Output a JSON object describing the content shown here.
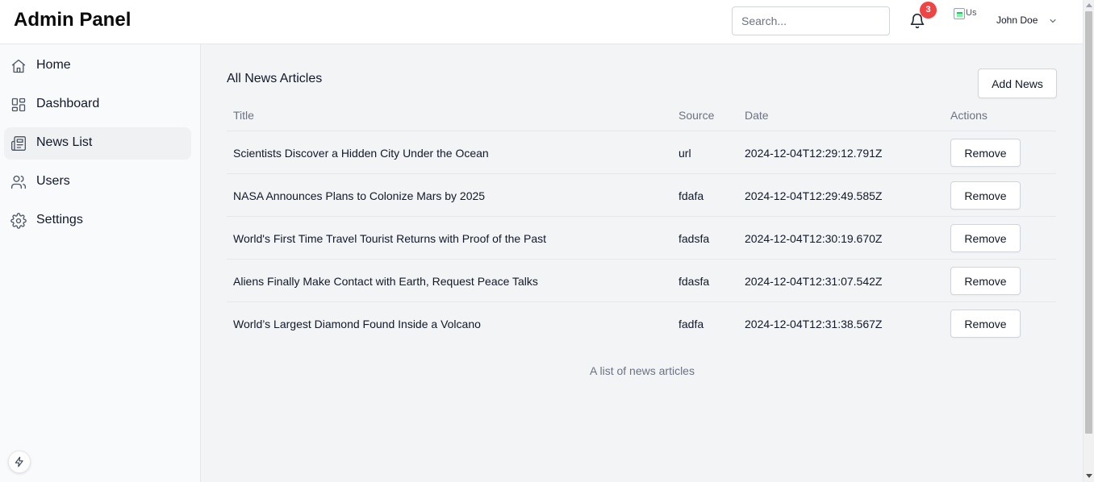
{
  "header": {
    "brand": "Admin Panel",
    "search_placeholder": "Search...",
    "notification_count": "3",
    "avatar_alt": "Us",
    "user_name": "John Doe"
  },
  "sidebar": {
    "items": [
      {
        "label": "Home",
        "icon": "home-icon",
        "active": false
      },
      {
        "label": "Dashboard",
        "icon": "dashboard-icon",
        "active": false
      },
      {
        "label": "News List",
        "icon": "newspaper-icon",
        "active": true
      },
      {
        "label": "Users",
        "icon": "users-icon",
        "active": false
      },
      {
        "label": "Settings",
        "icon": "settings-icon",
        "active": false
      }
    ]
  },
  "main": {
    "title": "All News Articles",
    "add_button": "Add News",
    "columns": [
      "Title",
      "Source",
      "Date",
      "Actions"
    ],
    "rows": [
      {
        "title": "Scientists Discover a Hidden City Under the Ocean",
        "source": "url",
        "date": "2024-12-04T12:29:12.791Z",
        "action": "Remove"
      },
      {
        "title": "NASA Announces Plans to Colonize Mars by 2025",
        "source": "fdafa",
        "date": "2024-12-04T12:29:49.585Z",
        "action": "Remove"
      },
      {
        "title": "World's First Time Travel Tourist Returns with Proof of the Past",
        "source": "fadsfa",
        "date": "2024-12-04T12:30:19.670Z",
        "action": "Remove"
      },
      {
        "title": "Aliens Finally Make Contact with Earth, Request Peace Talks",
        "source": "fdasfa",
        "date": "2024-12-04T12:31:07.542Z",
        "action": "Remove"
      },
      {
        "title": "World’s Largest Diamond Found Inside a Volcano",
        "source": "fadfa",
        "date": "2024-12-04T12:31:38.567Z",
        "action": "Remove"
      }
    ],
    "caption": "A list of news articles"
  },
  "colors": {
    "badge": "#ef4444",
    "sidebar_bg": "#f9fafb",
    "main_bg": "#f3f4f6",
    "active_item_bg": "#f0f1f3"
  }
}
